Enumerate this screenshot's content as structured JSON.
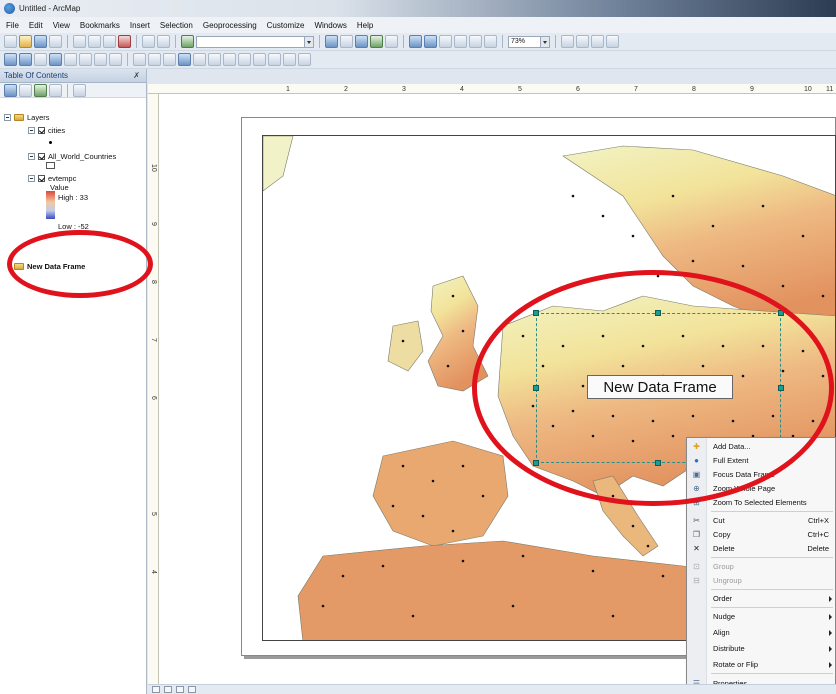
{
  "window": {
    "title": "Untitled - ArcMap"
  },
  "menu": [
    "File",
    "Edit",
    "View",
    "Bookmarks",
    "Insert",
    "Selection",
    "Geoprocessing",
    "Customize",
    "Windows",
    "Help"
  ],
  "toolbar": {
    "zoom_value": "73%"
  },
  "toc": {
    "title": "Table Of Contents",
    "controls": " ✗",
    "root": "Layers",
    "layers": [
      {
        "name": "cities"
      },
      {
        "name": "All_World_Countries"
      },
      {
        "name": "evtempc",
        "legend_title": "Value",
        "legend_high": "High : 33",
        "legend_low": "Low : -52"
      }
    ],
    "new_frame": "New Data Frame"
  },
  "ruler": {
    "h_ticks": [
      "1",
      "2",
      "3",
      "4",
      "5",
      "6",
      "7",
      "8",
      "9",
      "10",
      "11"
    ],
    "v_ticks": [
      "10",
      "9",
      "8",
      "7",
      "6",
      "5",
      "4"
    ]
  },
  "map": {
    "data_frame_label": "New Data Frame"
  },
  "context_menu": {
    "items": [
      {
        "label": "Add Data...",
        "icon": "add-data-icon",
        "shortcut": ""
      },
      {
        "label": "Full Extent",
        "icon": "globe-icon",
        "shortcut": ""
      },
      {
        "label": "Focus Data Frame",
        "icon": "focus-icon",
        "shortcut": ""
      },
      {
        "label": "Zoom Whole Page",
        "icon": "zoom-page-icon",
        "shortcut": ""
      },
      {
        "label": "Zoom To Selected Elements",
        "icon": "zoom-selected-icon",
        "shortcut": ""
      },
      {
        "label": "Cut",
        "icon": "scissors-icon",
        "shortcut": "Ctrl+X"
      },
      {
        "label": "Copy",
        "icon": "copy-icon",
        "shortcut": "Ctrl+C"
      },
      {
        "label": "Delete",
        "icon": "delete-icon",
        "shortcut": "Delete"
      },
      {
        "label": "Group",
        "icon": "group-icon",
        "shortcut": ""
      },
      {
        "label": "Ungroup",
        "icon": "ungroup-icon",
        "shortcut": ""
      },
      {
        "label": "Order",
        "icon": "",
        "shortcut": ""
      },
      {
        "label": "Nudge",
        "icon": "",
        "shortcut": ""
      },
      {
        "label": "Align",
        "icon": "",
        "shortcut": ""
      },
      {
        "label": "Distribute",
        "icon": "",
        "shortcut": ""
      },
      {
        "label": "Rotate or Flip",
        "icon": "",
        "shortcut": ""
      },
      {
        "label": "Properties...",
        "icon": "properties-icon",
        "shortcut": ""
      }
    ]
  },
  "colors": {
    "annotation_red": "#e0121b",
    "selection_teal": "#1d9c94"
  }
}
